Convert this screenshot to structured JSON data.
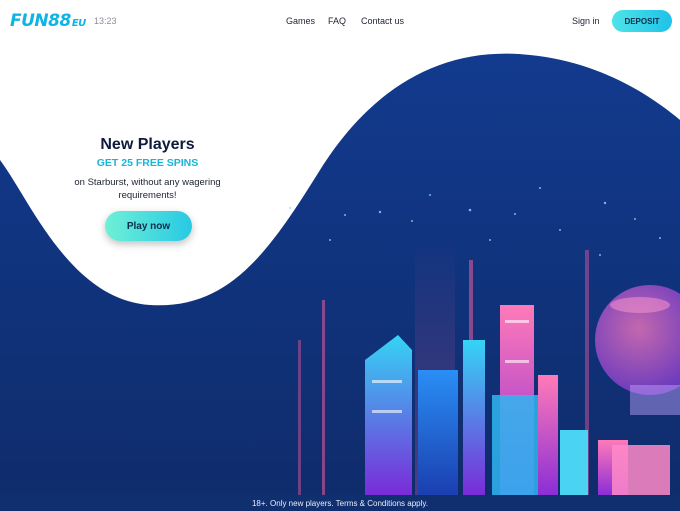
{
  "header": {
    "logo_main": "FUN88",
    "logo_suffix": "EU",
    "time": "13:23",
    "nav": [
      "Games",
      "FAQ",
      "Contact us"
    ],
    "signin_label": "Sign in",
    "deposit_label": "DEPOSIT"
  },
  "hero": {
    "title": "New Players",
    "subtitle": "GET 25 FREE SPINS",
    "description": "on Starburst, without any wagering requirements!",
    "cta_label": "Play now"
  },
  "footer": {
    "text": "18+. Only new players. Terms & Conditions apply."
  },
  "colors": {
    "brand": "#10b4e4",
    "background_navy": "#143a8a",
    "cta_gradient": [
      "#6ff0d6",
      "#27c9e4"
    ]
  }
}
